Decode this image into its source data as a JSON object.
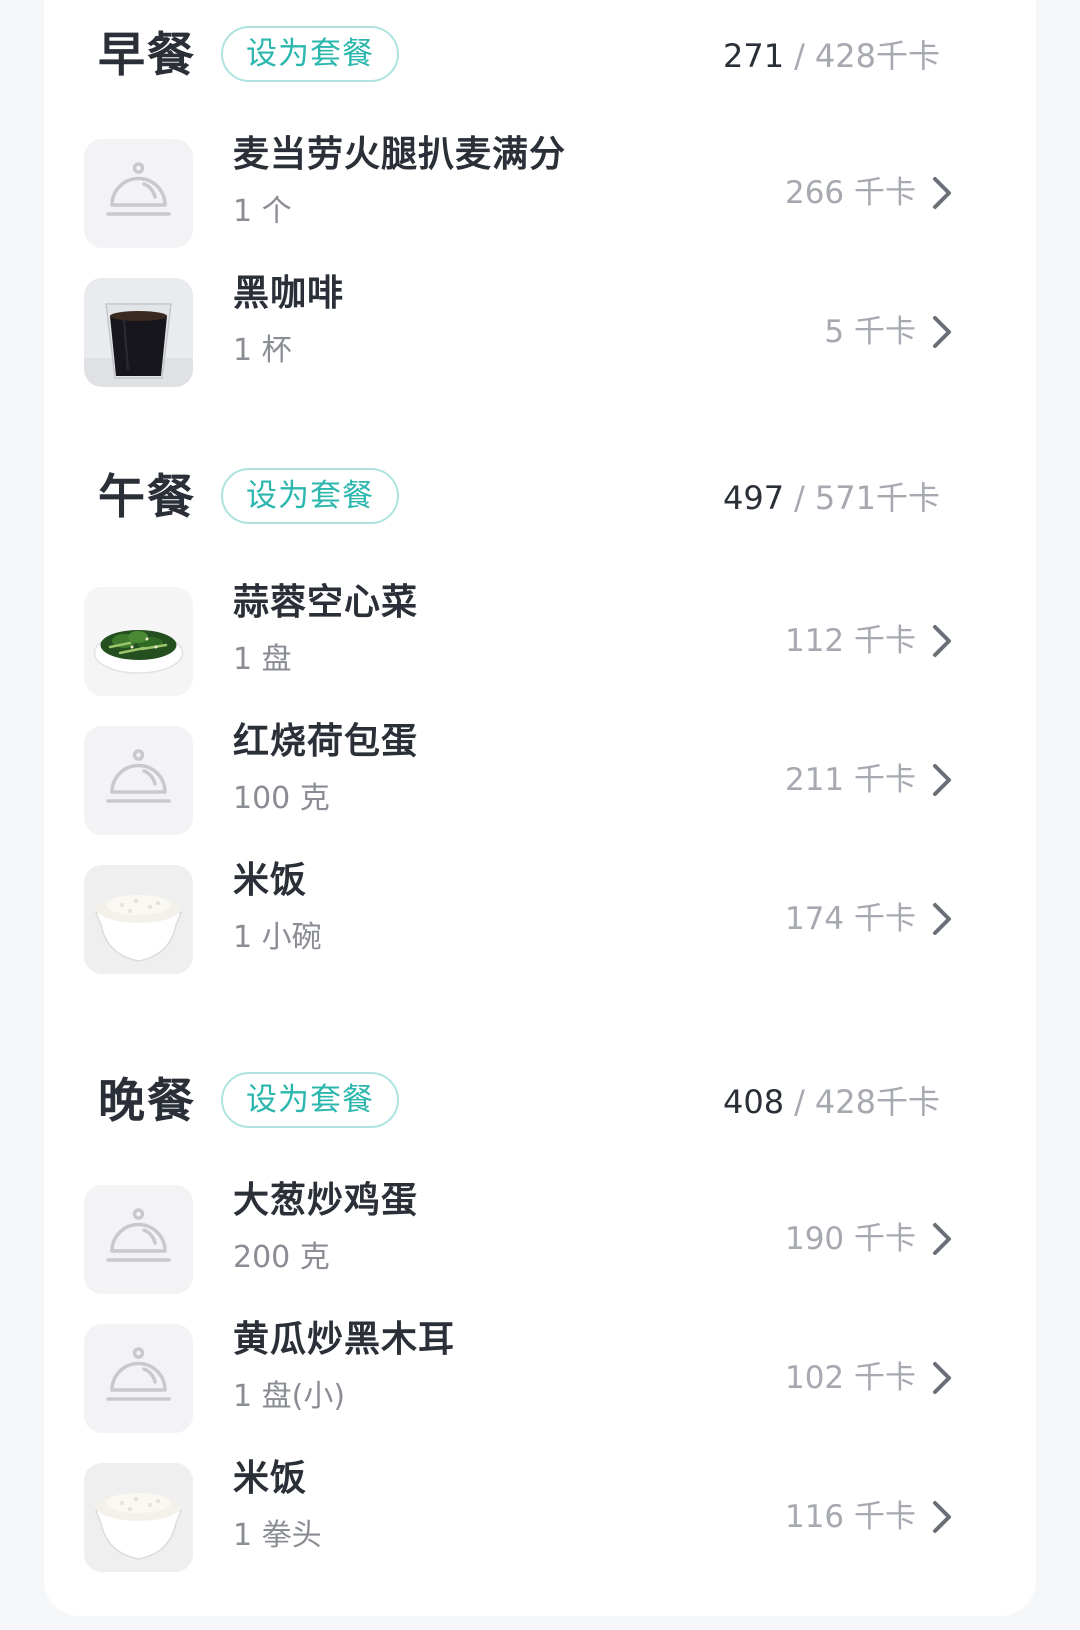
{
  "combo_label": "设为套餐",
  "meals": [
    {
      "title": "早餐",
      "eaten": "271",
      "target": "428千卡",
      "items": [
        {
          "name": "麦当劳火腿扒麦满分",
          "amount": "1 个",
          "kcal": "266 千卡",
          "thumb": "cloche-icon"
        },
        {
          "name": "黑咖啡",
          "amount": "1 杯",
          "kcal": "5 千卡",
          "thumb": "black-coffee-image"
        }
      ]
    },
    {
      "title": "午餐",
      "eaten": "497",
      "target": "571千卡",
      "items": [
        {
          "name": "蒜蓉空心菜",
          "amount": "1 盘",
          "kcal": "112 千卡",
          "thumb": "water-spinach-image"
        },
        {
          "name": "红烧荷包蛋",
          "amount": "100 克",
          "kcal": "211 千卡",
          "thumb": "cloche-icon"
        },
        {
          "name": "米饭",
          "amount": "1 小碗",
          "kcal": "174 千卡",
          "thumb": "rice-bowl-image"
        }
      ]
    },
    {
      "title": "晚餐",
      "eaten": "408",
      "target": "428千卡",
      "items": [
        {
          "name": "大葱炒鸡蛋",
          "amount": "200 克",
          "kcal": "190 千卡",
          "thumb": "cloche-icon"
        },
        {
          "name": "黄瓜炒黑木耳",
          "amount": "1 盘(小)",
          "kcal": "102 千卡",
          "thumb": "cloche-icon"
        },
        {
          "name": "米饭",
          "amount": "1 拳头",
          "kcal": "116 千卡",
          "thumb": "rice-bowl-image"
        }
      ]
    }
  ],
  "colors": {
    "accent": "#2cb7ae",
    "accent_border": "#aee3df",
    "text_primary": "#2a2f38",
    "text_secondary": "#8a8d94",
    "text_muted": "#a6a9b0",
    "thumb_bg": "#f3f3f6"
  }
}
